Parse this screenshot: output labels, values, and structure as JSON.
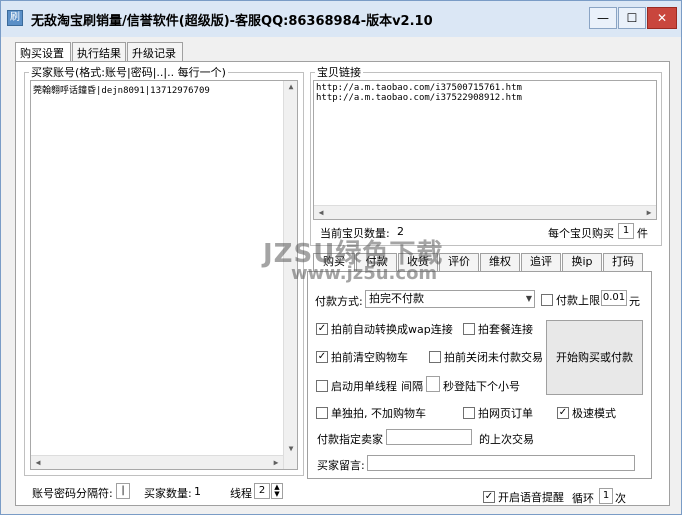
{
  "window": {
    "app_icon": "刷",
    "title": "无敌淘宝刷销量/信誉软件(超级版)-客服QQ:86368984-版本v2.10",
    "buttons": {
      "min": "—",
      "max": "☐",
      "close": "✕"
    }
  },
  "tabs": [
    "购买设置",
    "执行结果",
    "升级记录"
  ],
  "left": {
    "legend": "买家账号(格式:账号|密码|..|.. 每行一个)",
    "accounts_text": "莞翰翱呼话鐘昏|dejn8091|13712976709",
    "separator_label": "账号密码分隔符:",
    "separator_value": "|",
    "buyer_count_label": "买家数量:",
    "buyer_count_value": "1",
    "threads_label": "线程",
    "threads_value": "2"
  },
  "right": {
    "legend": "宝贝链接",
    "links": [
      "http://a.m.taobao.com/i37500715761.htm",
      "http://a.m.taobao.com/i37522908912.htm"
    ],
    "current_count_label": "当前宝贝数量:",
    "current_count_value": "2",
    "buy_each_label": "每个宝贝购买",
    "buy_each_value": "1",
    "buy_each_unit": "件"
  },
  "bottom_tabs": [
    "购买",
    "付款",
    "收货",
    "评价",
    "维权",
    "追评",
    "换ip",
    "打码"
  ],
  "buy": {
    "pay_method_label": "付款方式:",
    "pay_method_value": "拍完不付款",
    "pay_limit_label": "付款上限",
    "pay_limit_value": "0.01",
    "pay_limit_unit": "元",
    "options": {
      "auto_wap": "拍前自动转换成wap连接",
      "package_link": "拍套餐连接",
      "clear_cart": "拍前清空购物车",
      "close_unpaid": "拍前关闭未付款交易",
      "single_thread": "启动用单线程",
      "interval": "间隔",
      "seconds": "秒登陆下个小号",
      "no_cart": "单独拍, 不加购物车",
      "web_order": "拍网页订单",
      "fast_mode": "极速模式"
    },
    "checked": {
      "auto_wap": true,
      "package_link": false,
      "clear_cart": true,
      "close_unpaid": false,
      "single_thread": false,
      "interval": false,
      "no_cart": false,
      "web_order": false,
      "fast_mode": true,
      "voice": true,
      "pay_limit": false
    },
    "seller_label": "付款指定卖家",
    "last_trade_label": "的上次交易",
    "message_label": "买家留言:",
    "start_button": "开始购买或付款"
  },
  "footer": {
    "voice_label": "开启语音提醒",
    "loop_label": "循环",
    "loop_value": "1",
    "loop_unit": "次"
  },
  "watermark": {
    "line1": "JZSU绿色下载",
    "line2": "www.jz5u.com"
  },
  "colors": {
    "title_bar": "#dbe7f5",
    "close": "#c9463d"
  }
}
